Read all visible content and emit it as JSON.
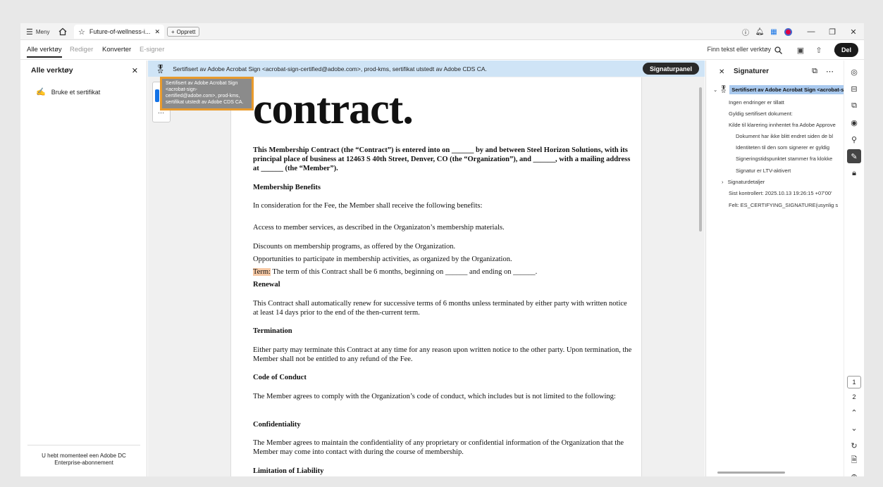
{
  "titlebar": {
    "menu_label": "Meny",
    "tab_title": "Future-of-wellness-i...",
    "new_label": "Opprett"
  },
  "menubar": {
    "items": [
      "Alle verktøy",
      "Rediger",
      "Konverter",
      "E-signer"
    ],
    "search_label": "Finn tekst eller verktøy",
    "share_label": "Del"
  },
  "left_panel": {
    "title": "Alle verktøy",
    "item_label": "Bruke et sertifikat",
    "footer": "U hebt momenteel een Adobe DC Enterprise-abonnement"
  },
  "cert_bar": {
    "text": "Sertifisert av Adobe Acrobat Sign <acrobat-sign-certified@adobe.com>, prod-kms, sertifikat utstedt av Adobe CDS CA.",
    "button": "Signaturpanel"
  },
  "tooltip": "Sertifisert av Adobe Acrobat Sign <acrobat-sign-certified@adobe.com>, prod-kms, sertifikat utstedt av Adobe CDS CA.",
  "document": {
    "heading": "contract.",
    "intro": "This Membership Contract (the “Contract”) is entered into on ______ by and between Steel Horizon Solutions, with its principal place of business at 12463 S 40th Street, Denver, CO (the “Organization”), and ______, with a mailing address at ______ (the “Member”).",
    "benefits_heading": "Membership Benefits",
    "benefits_intro": "In consideration for the Fee, the Member shall receive the following benefits:",
    "benefit_1": "Access to member services, as described in the Organizaton’s membership materials.",
    "benefit_2": "Discounts on membership programs, as offered by the Organization.",
    "benefit_3": "Opportunities to participate in membership activities, as organized by the Organization.",
    "term_label": "Term:",
    "term_text": " The term of this Contract shall be 6 months, beginning on ______ and ending on ______.",
    "renewal_heading": "Renewal",
    "renewal_text": "This Contract shall automatically renew for successive terms of 6 months unless terminated by either party with written notice at least 14 days prior to the end of the then-current term.",
    "termination_heading": "Termination",
    "termination_text": "Either party may terminate this Contract at any time for any reason upon written notice to the other party. Upon termination, the Member shall not be entitled to any refund of the Fee.",
    "conduct_heading": "Code of Conduct",
    "conduct_text": "The Member agrees to comply with the Organization’s code of conduct, which includes but is not limited to the following:",
    "confidentiality_heading": "Confidentiality",
    "confidentiality_text": "The Member agrees to maintain the confidentiality of any proprietary or confidential information of the Organization that the Member may come into contact with during the course of membership.",
    "liability_heading": "Limitation of Liability"
  },
  "signature_panel": {
    "title": "Signaturer",
    "root": "Sertifisert av Adobe Acrobat Sign <acrobat-s",
    "items": [
      "Ingen endringer er tillatt",
      "Gyldig sertifisert dokument:",
      "Kilde til klarering innhentet fra Adobe Approve",
      "Dokument har ikke blitt endret siden de bl",
      "Identiteten til den som signerer er gyldig",
      "Signeringstidspunktet stammer fra klokke",
      "Signatur er LTV-aktivert",
      "Signaturdetaljer",
      "Sist kontrollert: 2025.10.13 19:26:15 +07'00'",
      "Felt: ES_CERTIFYING_SIGNATURE(usynlig s"
    ]
  },
  "pages": [
    "1",
    "2"
  ]
}
